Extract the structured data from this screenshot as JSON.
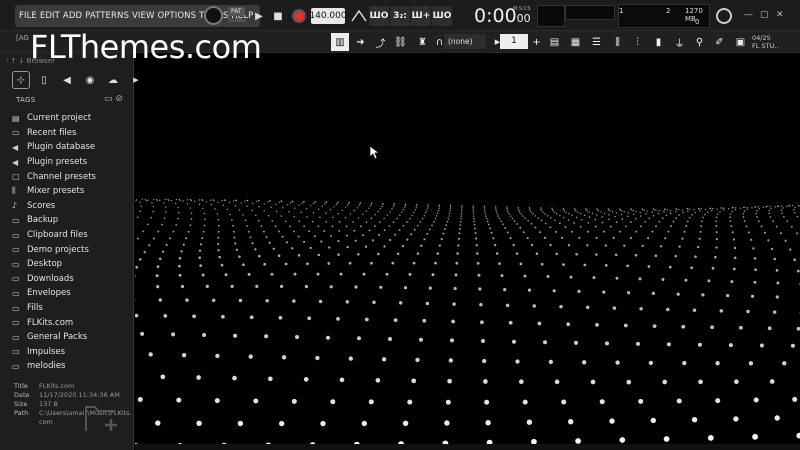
{
  "menu": [
    "FILE",
    "EDIT",
    "ADD",
    "PATTERNS",
    "VIEW",
    "OPTIONS",
    "TOOLS",
    "HELP"
  ],
  "transport": {
    "pat_label": "PAT",
    "song_label": "SONG",
    "tempo": "140.000"
  },
  "time": {
    "main": "0:00",
    "ms": "00",
    "mscs_label": "M:S:CS"
  },
  "info": {
    "voices": "1",
    "cpu": "2",
    "memory": "1270 MB",
    "zero": "0"
  },
  "snap": "(none)",
  "pattern_number": "1",
  "date_label": {
    "line1": "04/25",
    "line2": "FL STU.."
  },
  "hint_prefix": "[AG",
  "watermark": "FLThemes.com",
  "browser": {
    "title": "Browser",
    "tags_label": "TAGS",
    "items": [
      {
        "icon": "doc",
        "label": "Current project"
      },
      {
        "icon": "folder",
        "label": "Recent files"
      },
      {
        "icon": "plug",
        "label": "Plugin database"
      },
      {
        "icon": "plug",
        "label": "Plugin presets"
      },
      {
        "icon": "channel",
        "label": "Channel presets"
      },
      {
        "icon": "mixer",
        "label": "Mixer presets"
      },
      {
        "icon": "note",
        "label": "Scores"
      },
      {
        "icon": "folder",
        "label": "Backup"
      },
      {
        "icon": "folder",
        "label": "Clipboard files"
      },
      {
        "icon": "folder",
        "label": "Demo projects"
      },
      {
        "icon": "folder",
        "label": "Desktop"
      },
      {
        "icon": "folder",
        "label": "Downloads"
      },
      {
        "icon": "folder",
        "label": "Envelopes"
      },
      {
        "icon": "folder",
        "label": "Fills"
      },
      {
        "icon": "folder",
        "label": "FLKits.com"
      },
      {
        "icon": "folder",
        "label": "General Packs"
      },
      {
        "icon": "folder",
        "label": "Impulses"
      },
      {
        "icon": "folder",
        "label": "melodies"
      }
    ],
    "file_info": {
      "title_key": "Title",
      "title_val": "FLKits.com",
      "date_key": "Date",
      "date_val": "11/17/2020 11:34:36 AM",
      "size_key": "Size",
      "size_val": "137 B",
      "path_key": "Path",
      "path_val": "C:\\Users\\umair\\Music\\FLKits.",
      "path_val2": "com"
    }
  },
  "colors": {
    "record": "#d33333",
    "background": "#000000",
    "panel": "#1e1e1e"
  }
}
